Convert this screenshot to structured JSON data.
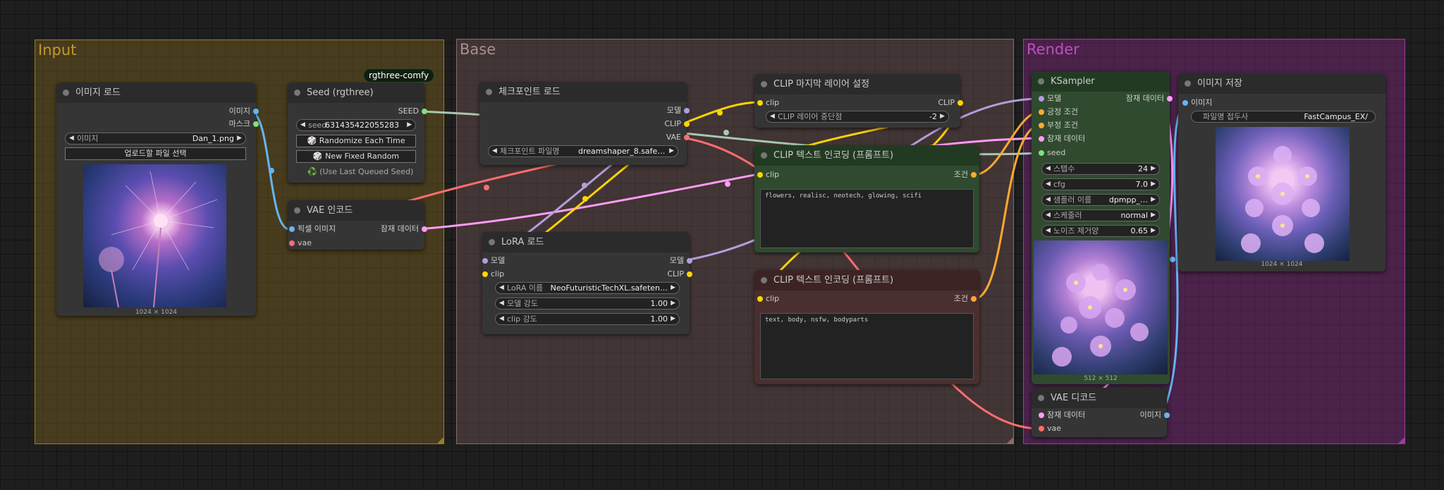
{
  "groups": {
    "input": "Input",
    "base": "Base",
    "render": "Render"
  },
  "badge": "rgthree-comfy",
  "colors": {
    "model": "#b39ddb",
    "clip": "#ffd500",
    "vae": "#ff6e6e",
    "latent": "#ff9cf9",
    "image": "#64b5f6",
    "cond": "#ffa931",
    "seed": "#7fe07f"
  },
  "load_image": {
    "title": "이미지 로드",
    "out_image": "이미지",
    "out_mask": "마스크",
    "w_image_label": "이미지",
    "w_image_value": "Dan_1.png",
    "upload_button": "업로드할 파일 선택",
    "caption": "1024 × 1024"
  },
  "seed_node": {
    "title": "Seed (rgthree)",
    "out_seed": "SEED",
    "w_seed_label": "seed",
    "w_seed_value": "631435422055283",
    "btn_randomize": "🎲 Randomize Each Time",
    "btn_new_fixed": "🎲 New Fixed Random",
    "status": "♻️ (Use Last Queued Seed)"
  },
  "vae_encode": {
    "title": "VAE 인코드",
    "in_pixels": "픽셀 이미지",
    "in_vae": "vae",
    "out_latent": "잠재 데이터"
  },
  "checkpoint": {
    "title": "체크포인트 로드",
    "out_model": "모델",
    "out_clip": "CLIP",
    "out_vae": "VAE",
    "w_ckpt_label": "체크포인트 파일명",
    "w_ckpt_value": "dreamshaper_8.safet…"
  },
  "lora": {
    "title": "LoRA 로드",
    "in_model": "모델",
    "in_clip": "clip",
    "out_model": "모델",
    "out_clip": "CLIP",
    "w_name_label": "LoRA 이름",
    "w_name_value": "NeoFuturisticTechXL.safeten…",
    "w_model_label": "모델 강도",
    "w_model_value": "1.00",
    "w_clip_label": "clip 강도",
    "w_clip_value": "1.00"
  },
  "clip_skip": {
    "title": "CLIP 마지막 레이어 설정",
    "in_clip": "clip",
    "out_clip": "CLIP",
    "w_label": "CLIP 레이어 중단점",
    "w_value": "-2"
  },
  "clip_pos": {
    "title": "CLIP 텍스트 인코딩 (프롬프트)",
    "in_clip": "clip",
    "out_cond": "조건",
    "text": "flowers, realisc, neotech, glowing, scifi"
  },
  "clip_neg": {
    "title": "CLIP 텍스트 인코딩 (프롬프트)",
    "in_clip": "clip",
    "out_cond": "조건",
    "text": "text, body, nsfw, bodyparts"
  },
  "ksampler": {
    "title": "KSampler",
    "in_model": "모델",
    "in_pos": "긍정 조건",
    "in_neg": "부정 조건",
    "in_latent": "잠재 데이터",
    "in_seed": "seed",
    "out_latent": "잠재 데이터",
    "w_steps_label": "스텝수",
    "w_steps_value": "24",
    "w_cfg_label": "cfg",
    "w_cfg_value": "7.0",
    "w_sampler_label": "샘플러 이름",
    "w_sampler_value": "dpmpp_…",
    "w_scheduler_label": "스케줄러",
    "w_scheduler_value": "normal",
    "w_denoise_label": "노이즈 제거양",
    "w_denoise_value": "0.65",
    "caption": "512 × 512"
  },
  "save_image": {
    "title": "이미지 저장",
    "in_images": "이미지",
    "w_prefix_label": "파일명 접두사",
    "w_prefix_value": "FastCampus_EX/",
    "caption": "1024 × 1024"
  },
  "vae_decode": {
    "title": "VAE 디코드",
    "in_latent": "잠재 데이터",
    "in_vae": "vae",
    "out_image": "이미지"
  }
}
